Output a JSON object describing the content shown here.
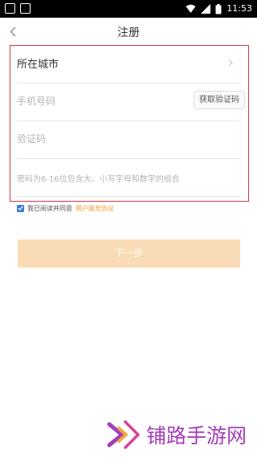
{
  "status_bar": {
    "time": "11:53"
  },
  "nav": {
    "title": "注册"
  },
  "form": {
    "city_label": "所在城市",
    "phone_placeholder": "手机号码",
    "get_code_button": "获取验证码",
    "code_placeholder": "验证码",
    "password_placeholder": "密码为6-16位包含大、小写字母和数字的组合"
  },
  "agreement": {
    "text": "我已阅读并同意",
    "link": "用户服务协议",
    "checked": true
  },
  "next_button": "下一步",
  "watermark": {
    "text": "铺路手游网"
  },
  "colors": {
    "accent": "#f29b38",
    "button_bg": "#f9dcb6",
    "highlight_border": "#d9363e",
    "checkbox": "#3a7bd5",
    "watermark": "#a53db8"
  }
}
